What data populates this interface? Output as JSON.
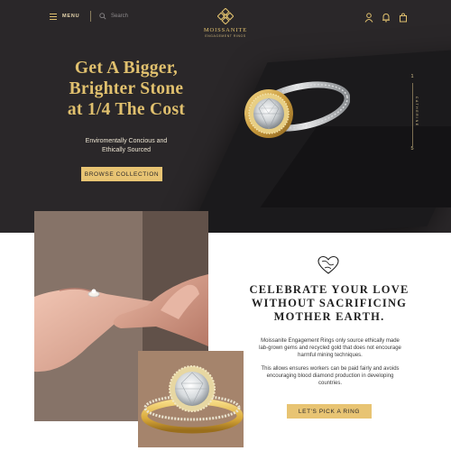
{
  "header": {
    "menu_label": "MENU",
    "search_placeholder": "Search",
    "brand_name": "MOISSANITE",
    "brand_tagline": "ENGAGEMENT RINGS",
    "icons": [
      "user-icon",
      "bell-icon",
      "shopping-bag-icon"
    ]
  },
  "hero": {
    "headline_line1": "Get A Bigger,",
    "headline_line2": "Brighter Stone",
    "headline_line3": "at 1/4 The Cost",
    "subline_line1": "Enviromentally Concious and",
    "subline_line2": "Ethically Sourced",
    "cta_label": "BROWSE COLLECTION"
  },
  "pager": {
    "current": "1",
    "name": "CATHERINE",
    "total": "5"
  },
  "story": {
    "title_line1": "CELEBRATE YOUR LOVE",
    "title_line2": "WITHOUT SACRIFICING",
    "title_line3": "MOTHER EARTH.",
    "paragraph1": "Moissanite Engagement Rings only source ethically made lab-grown gems and recycled gold that does not encourage harmful mining techniques.",
    "paragraph2": "This allows ensures workers can be paid fairly and avoids encouraging blood diamond production in developing countries.",
    "cta_label": "LET'S PICK A RING"
  },
  "colors": {
    "hero_bg": "#2a2729",
    "gold": "#e0c06e",
    "button_gold": "#e8c473",
    "ring_card_bg": "#a5846c"
  }
}
